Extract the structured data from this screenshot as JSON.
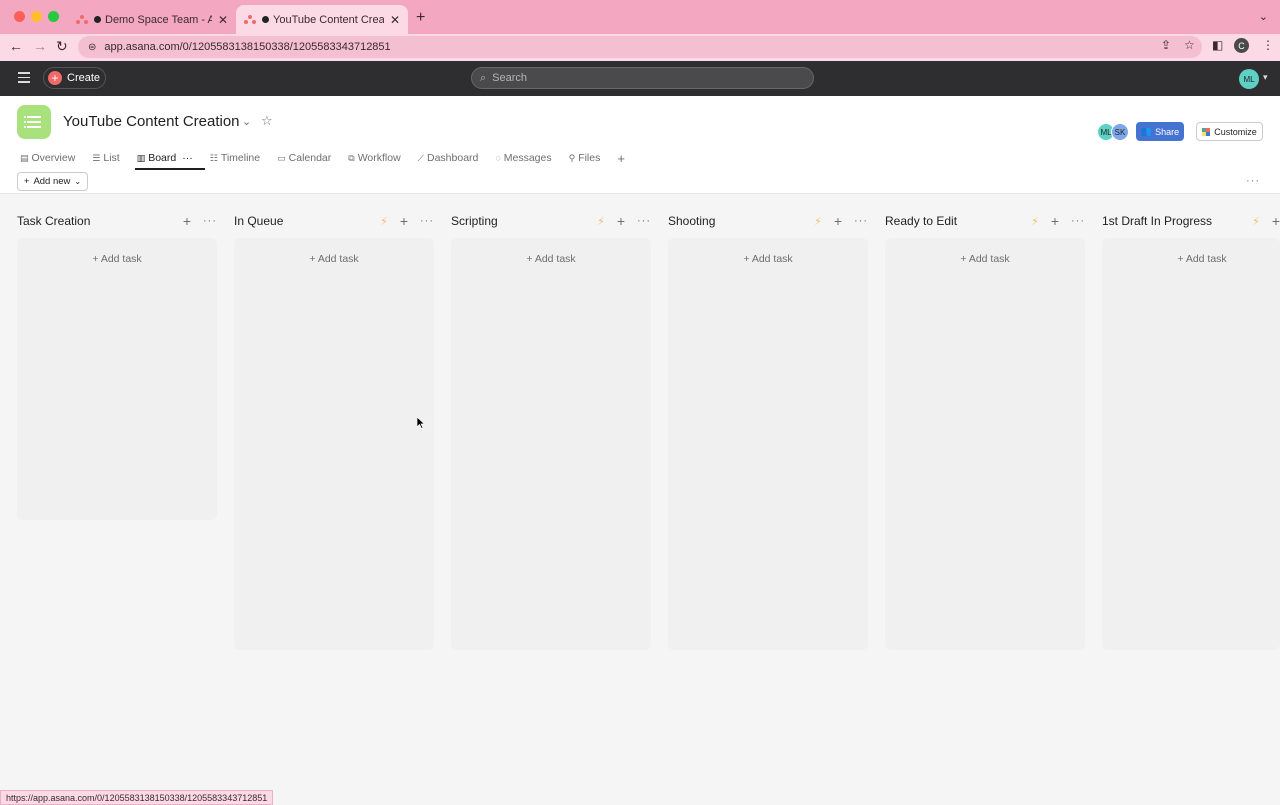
{
  "browser": {
    "tabs": [
      {
        "title": "Demo Space Team - Asana",
        "active": false
      },
      {
        "title": "YouTube Content Creation -",
        "active": true
      }
    ],
    "url": "app.asana.com/0/1205583138150338/1205583343712851",
    "status_url": "https://app.asana.com/0/1205583138150338/1205583343712851",
    "profile_initial": "C"
  },
  "topbar": {
    "create_label": "Create",
    "search_placeholder": "Search",
    "user_initials": "ML"
  },
  "project": {
    "title": "YouTube Content Creation",
    "members": [
      "ML",
      "SK"
    ],
    "share_label": "Share",
    "customize_label": "Customize",
    "add_new_label": "Add new",
    "tabs": [
      {
        "label": "Overview",
        "icon": "overview-icon"
      },
      {
        "label": "List",
        "icon": "list-icon"
      },
      {
        "label": "Board",
        "icon": "board-icon",
        "active": true
      },
      {
        "label": "Timeline",
        "icon": "timeline-icon"
      },
      {
        "label": "Calendar",
        "icon": "calendar-icon"
      },
      {
        "label": "Workflow",
        "icon": "workflow-icon"
      },
      {
        "label": "Dashboard",
        "icon": "dashboard-icon"
      },
      {
        "label": "Messages",
        "icon": "messages-icon"
      },
      {
        "label": "Files",
        "icon": "files-icon"
      }
    ]
  },
  "board": {
    "add_task_label": "Add task",
    "columns": [
      {
        "title": "Task Creation",
        "has_rule": false
      },
      {
        "title": "In Queue",
        "has_rule": true
      },
      {
        "title": "Scripting",
        "has_rule": true
      },
      {
        "title": "Shooting",
        "has_rule": true
      },
      {
        "title": "Ready to Edit",
        "has_rule": true
      },
      {
        "title": "1st Draft In Progress",
        "has_rule": true
      }
    ]
  },
  "colors": {
    "tab_bar": "#f4a7c1",
    "topbar": "#2e2e30",
    "accent": "#4573d2",
    "create_plus": "#f06a6a",
    "project_icon": "#a9e17c",
    "rule_bolt": "#f1bd6c"
  }
}
